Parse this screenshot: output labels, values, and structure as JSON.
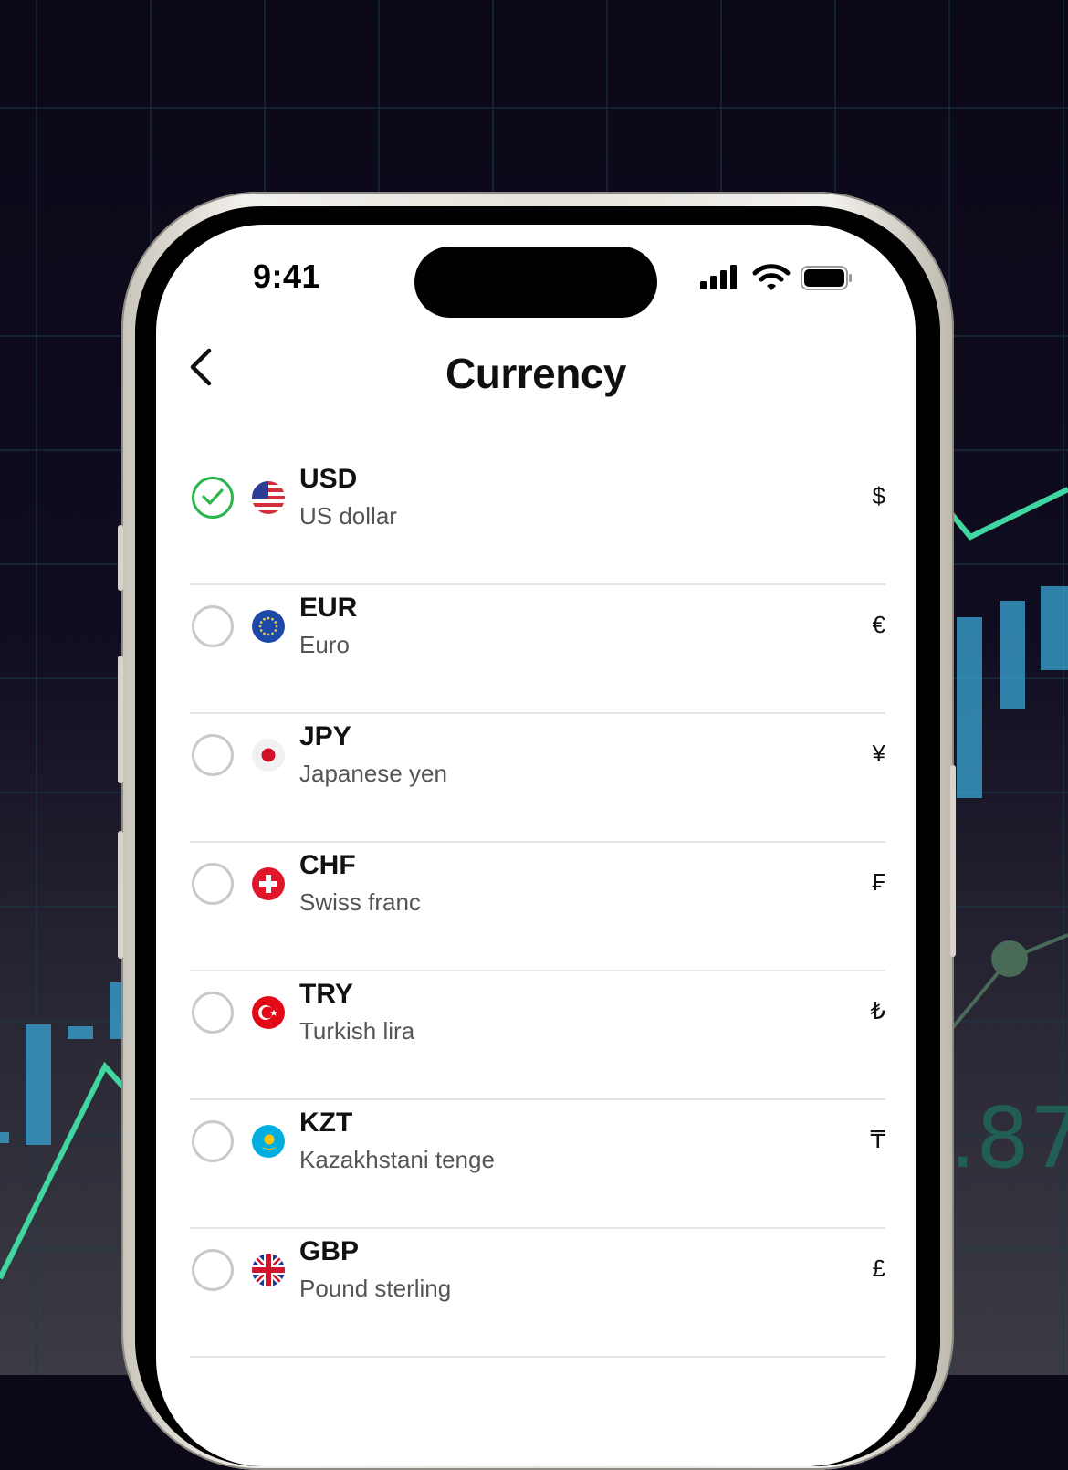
{
  "status_bar": {
    "time": "9:41"
  },
  "header": {
    "title": "Currency"
  },
  "currencies": [
    {
      "code": "USD",
      "name": "US dollar",
      "symbol": "$",
      "selected": true
    },
    {
      "code": "EUR",
      "name": "Euro",
      "symbol": "€",
      "selected": false
    },
    {
      "code": "JPY",
      "name": "Japanese yen",
      "symbol": "¥",
      "selected": false
    },
    {
      "code": "CHF",
      "name": "Swiss franc",
      "symbol": "₣",
      "selected": false
    },
    {
      "code": "TRY",
      "name": "Turkish lira",
      "symbol": "₺",
      "selected": false
    },
    {
      "code": "KZT",
      "name": "Kazakhstani tenge",
      "symbol": "₸",
      "selected": false
    },
    {
      "code": "GBP",
      "name": "Pound sterling",
      "symbol": "£",
      "selected": false
    }
  ],
  "colors": {
    "selected_accent": "#2bb54b",
    "chart_line": "#3fd6a0",
    "chart_bar": "#3aa7d6"
  },
  "icons": [
    "back-chevron-icon",
    "checkmark-icon",
    "signal-icon",
    "wifi-icon",
    "battery-icon",
    "flag-us-icon",
    "flag-eu-icon",
    "flag-jp-icon",
    "flag-ch-icon",
    "flag-tr-icon",
    "flag-kz-icon",
    "flag-gb-icon"
  ]
}
